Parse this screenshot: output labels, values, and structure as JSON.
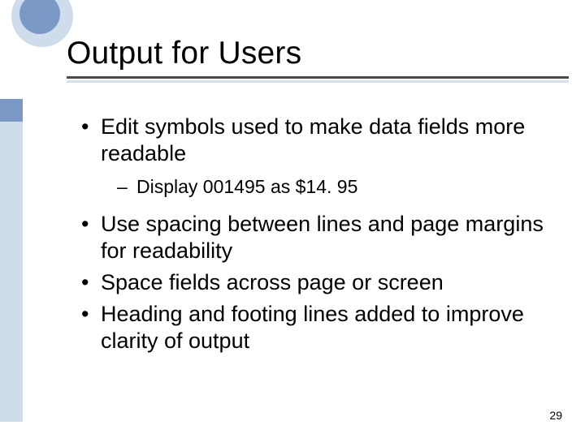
{
  "title": "Output for Users",
  "bullets": [
    {
      "text": "Edit symbols used to make data fields more readable",
      "sub": [
        {
          "text": "Display 001495 as $14. 95"
        }
      ]
    },
    {
      "text": "Use spacing between lines and page margins for readability"
    },
    {
      "text": "Space fields across page or screen"
    },
    {
      "text": "Heading and footing lines added to improve clarity of output"
    }
  ],
  "page_number": "29"
}
